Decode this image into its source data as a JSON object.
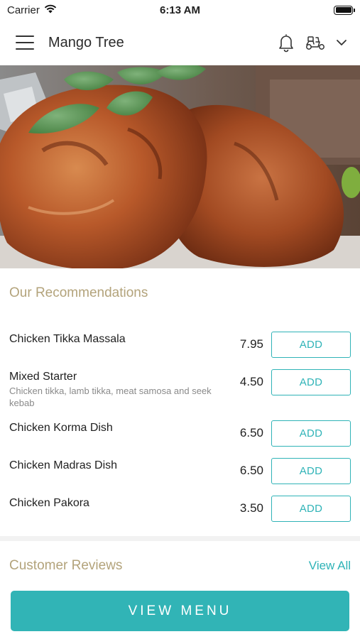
{
  "status_bar": {
    "carrier": "Carrier",
    "time": "6:13 AM",
    "battery_level": 1.0
  },
  "header": {
    "title": "Mango Tree",
    "icons": [
      "menu-icon",
      "bell-icon",
      "scooter-icon",
      "chevron-down-icon"
    ]
  },
  "hero": {
    "image": "grilled-chicken-with-mint"
  },
  "recommendations": {
    "title": "Our Recommendations",
    "items": [
      {
        "name": "Chicken Tikka Massala",
        "description": "",
        "price": "7.95",
        "button": "ADD"
      },
      {
        "name": "Mixed Starter",
        "description": "Chicken tikka, lamb tikka, meat samosa and seek kebab",
        "price": "4.50",
        "button": "ADD"
      },
      {
        "name": "Chicken Korma Dish",
        "description": "",
        "price": "6.50",
        "button": "ADD"
      },
      {
        "name": "Chicken Madras Dish",
        "description": "",
        "price": "6.50",
        "button": "ADD"
      },
      {
        "name": "Chicken Pakora",
        "description": "",
        "price": "3.50",
        "button": "ADD"
      }
    ]
  },
  "reviews": {
    "title": "Customer Reviews",
    "view_all": "View All"
  },
  "footer": {
    "view_menu": "VIEW MENU"
  },
  "colors": {
    "accent": "#2fb3b7",
    "section_title": "#b3a37b",
    "button_bg": "#31b4b6"
  }
}
